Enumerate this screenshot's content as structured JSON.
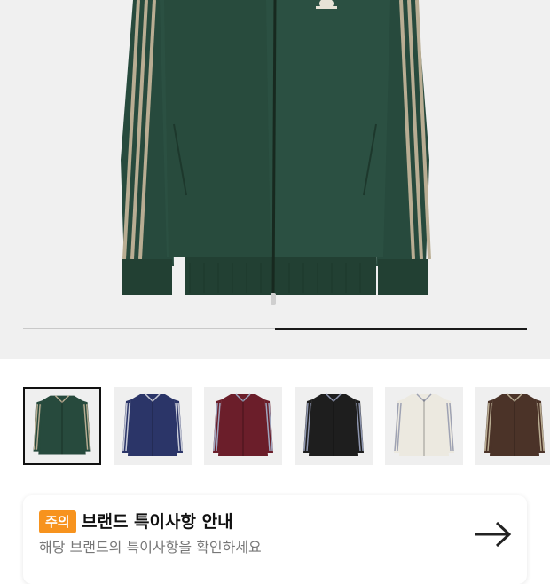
{
  "product": {
    "colors": {
      "selected_jacket": "#274a3d",
      "stripe": "#b9ad93"
    },
    "gallery_progress": 0.5
  },
  "color_options": [
    {
      "name": "green",
      "body": "#274a3d",
      "stripe": "#b9ad93",
      "selected": true
    },
    {
      "name": "navy",
      "body": "#2b3568",
      "stripe": "#c9ccd8",
      "selected": false
    },
    {
      "name": "burgundy",
      "body": "#6b1e2a",
      "stripe": "#9fa6bf",
      "selected": false
    },
    {
      "name": "black",
      "body": "#1e1e1e",
      "stripe": "#8f97b0",
      "selected": false
    },
    {
      "name": "cream",
      "body": "#ece9e0",
      "stripe": "#9ea2b3",
      "selected": false
    },
    {
      "name": "brown",
      "body": "#4b3328",
      "stripe": "#b9ad93",
      "selected": false
    }
  ],
  "notice": {
    "badge": "주의",
    "title": "브랜드 특이사항 안내",
    "subtitle": "해당 브랜드의 특이사항을 확인하세요"
  },
  "icons": {
    "arrow": "arrow-right-icon",
    "logo": "trefoil-logo-icon"
  }
}
